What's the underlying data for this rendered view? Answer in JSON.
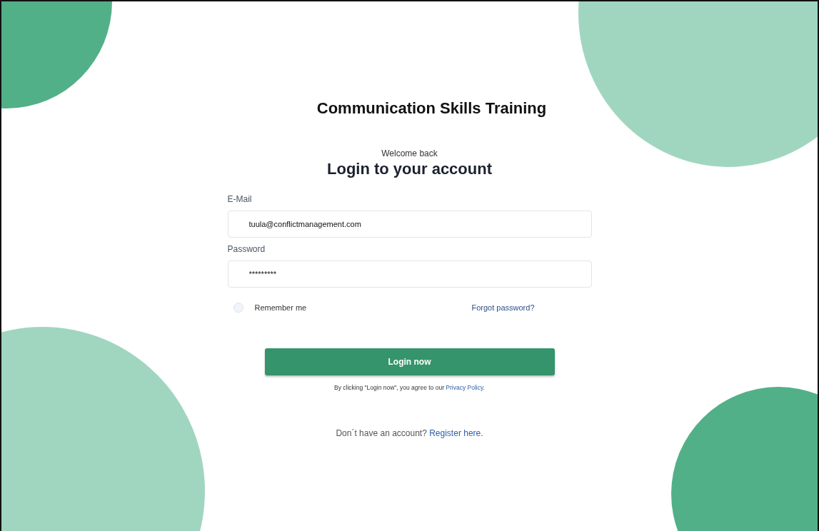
{
  "app_title": "Communication Skills Training",
  "subtitle": "Welcome back",
  "heading": "Login to your account",
  "fields": [
    {
      "label": "E-Mail",
      "value": "tuula@conflictmanagement.com"
    },
    {
      "label": "Password",
      "value": "*********"
    }
  ],
  "remember": {
    "label": "Remember me",
    "checked": false
  },
  "forgot_link": "Forgot password?",
  "login_button": "Login now",
  "terms": {
    "text": "By clicking \"Login now\", you agree to our ",
    "link": "Privacy Policy."
  },
  "register": {
    "text": "Don´t have an account? ",
    "link": "Register here."
  }
}
